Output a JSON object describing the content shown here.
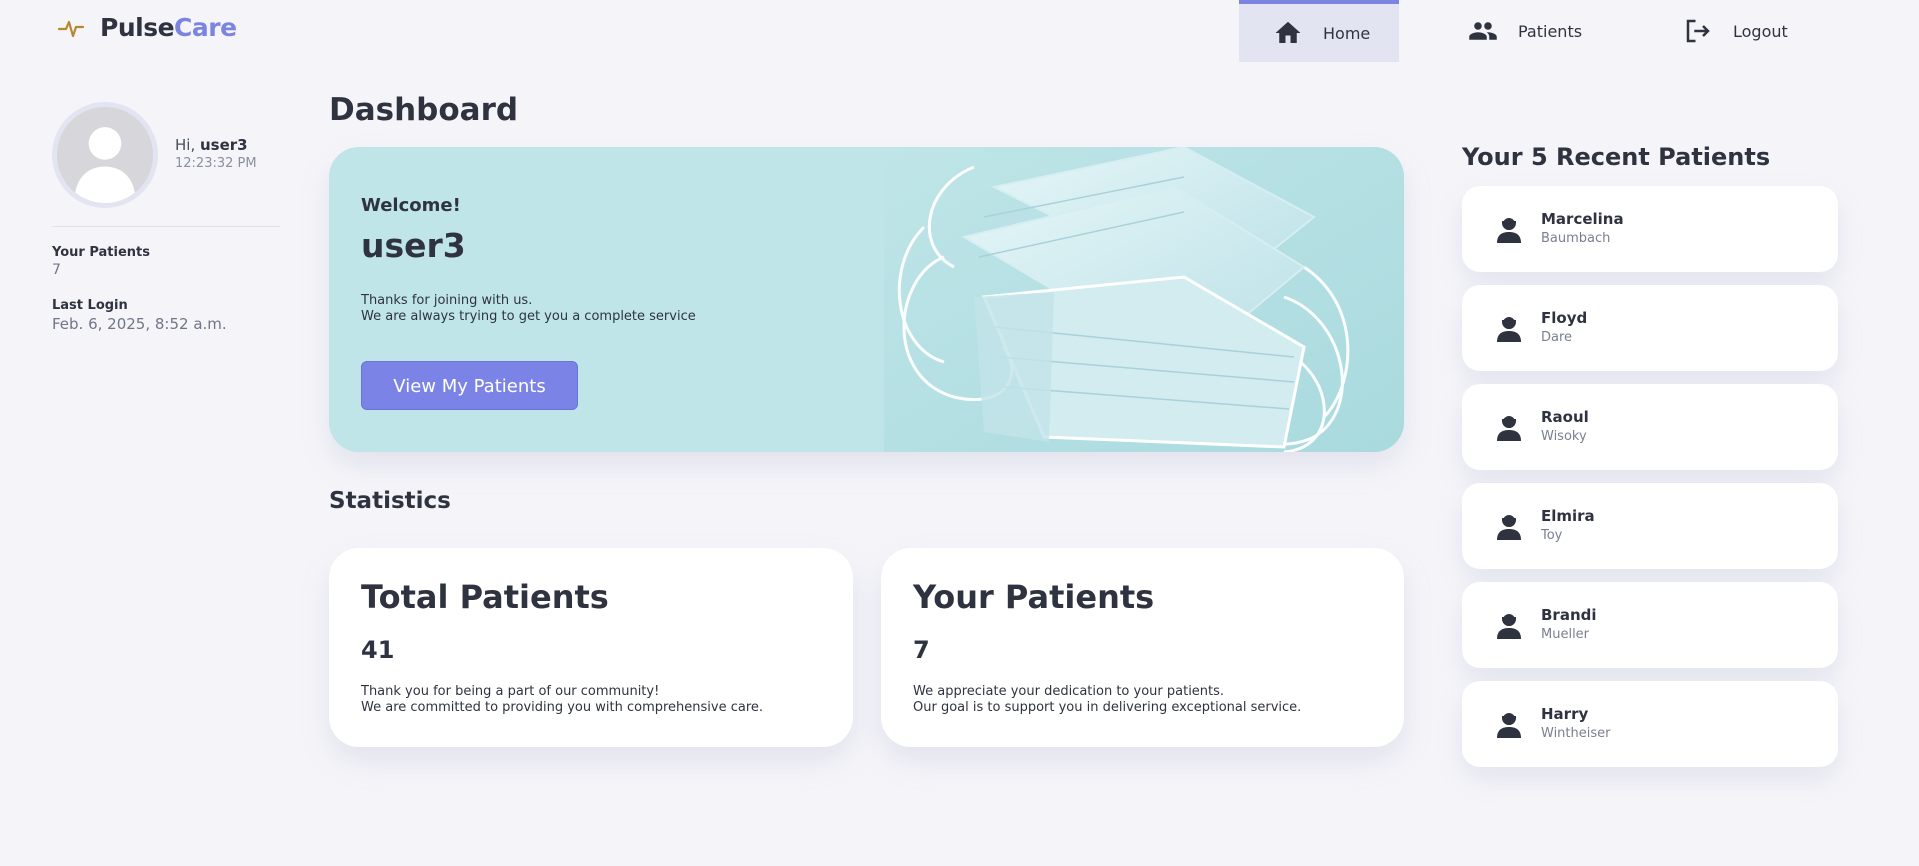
{
  "brand": {
    "part1": "Pulse",
    "part2": "Care",
    "accent": "#7b84e0"
  },
  "nav": [
    {
      "label": "Home",
      "icon": "home-icon",
      "active": true
    },
    {
      "label": "Patients",
      "icon": "patients-icon",
      "active": false
    },
    {
      "label": "Logout",
      "icon": "logout-icon",
      "active": false
    }
  ],
  "profile": {
    "greeting": "Hi,",
    "username": "user3",
    "time": "12:23:32 PM",
    "your_patients_label": "Your Patients",
    "your_patients_value": "7",
    "last_login_label": "Last Login",
    "last_login_value": "Feb. 6, 2025, 8:52 a.m."
  },
  "main": {
    "title": "Dashboard",
    "hero": {
      "welcome": "Welcome!",
      "user": "user3",
      "line1": "Thanks for joining with us.",
      "line2": "We are always trying to get you a complete service",
      "button": "View My Patients"
    },
    "statistics_title": "Statistics",
    "cards": [
      {
        "title": "Total Patients",
        "value": "41",
        "line1": "Thank you for being a part of our community!",
        "line2": "We are committed to providing you with comprehensive care."
      },
      {
        "title": "Your Patients",
        "value": "7",
        "line1": "We appreciate your dedication to your patients.",
        "line2": "Our goal is to support you in delivering exceptional service."
      }
    ]
  },
  "recent": {
    "title": "Your 5 Recent Patients",
    "patients": [
      {
        "first": "Marcelina",
        "last": "Baumbach"
      },
      {
        "first": "Floyd",
        "last": "Dare"
      },
      {
        "first": "Raoul",
        "last": "Wisoky"
      },
      {
        "first": "Elmira",
        "last": "Toy"
      },
      {
        "first": "Brandi",
        "last": "Mueller"
      },
      {
        "first": "Harry",
        "last": "Wintheiser"
      }
    ]
  }
}
